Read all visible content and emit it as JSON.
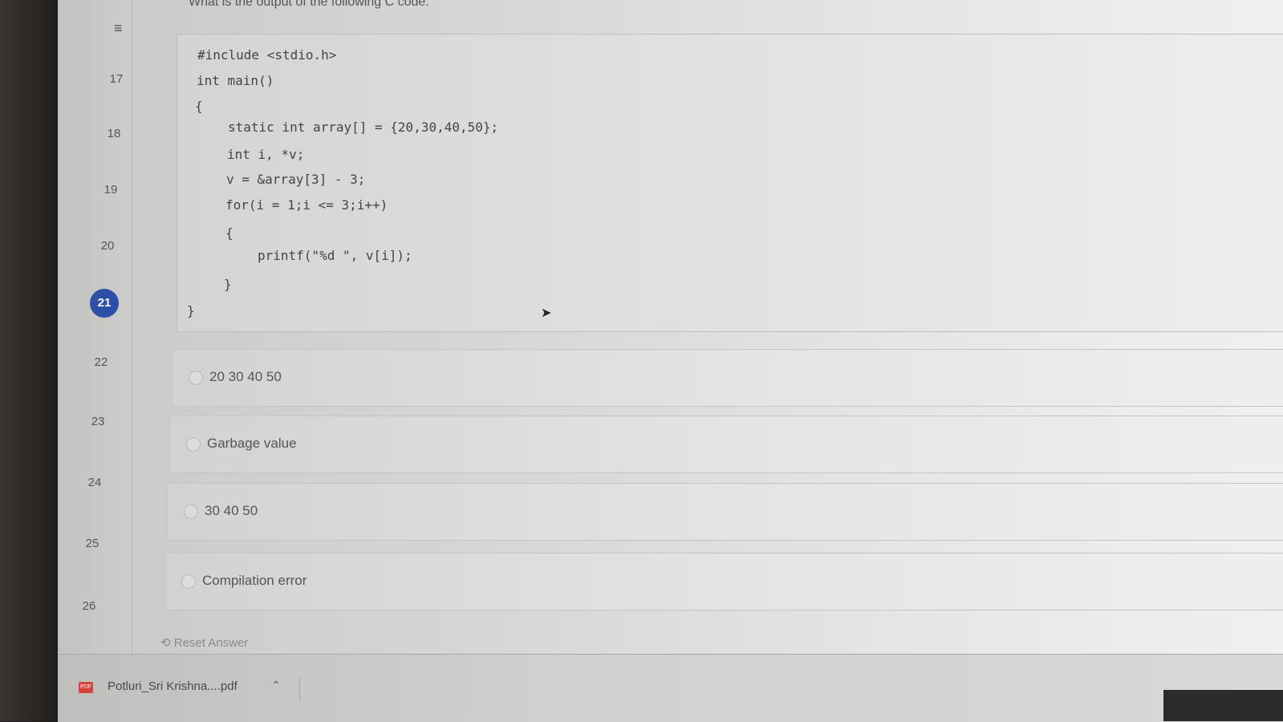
{
  "question": {
    "text": "What is the output of the following C code:",
    "code": [
      "#include <stdio.h>",
      "int main()",
      "{",
      "static int array[] = {20,30,40,50};",
      "int i, *v;",
      "v = &array[3] - 3;",
      "for(i = 1;i <= 3;i++)",
      "{",
      "printf(\"%d \", v[i]);",
      "}",
      "}"
    ]
  },
  "nav": {
    "menu_icon": "menu-icon",
    "numbers": [
      "17",
      "18",
      "19",
      "20",
      "21",
      "22",
      "23",
      "24",
      "25",
      "26"
    ],
    "active": "21",
    "active_color": "#2d4fa8"
  },
  "options": [
    {
      "label": "20 30 40 50"
    },
    {
      "label": "Garbage value"
    },
    {
      "label": "30 40 50"
    },
    {
      "label": "Compilation error"
    }
  ],
  "reset_label": "Reset Answer",
  "download": {
    "file_name": "Potluri_Sri Krishna....pdf",
    "icon_text": "PDF"
  }
}
